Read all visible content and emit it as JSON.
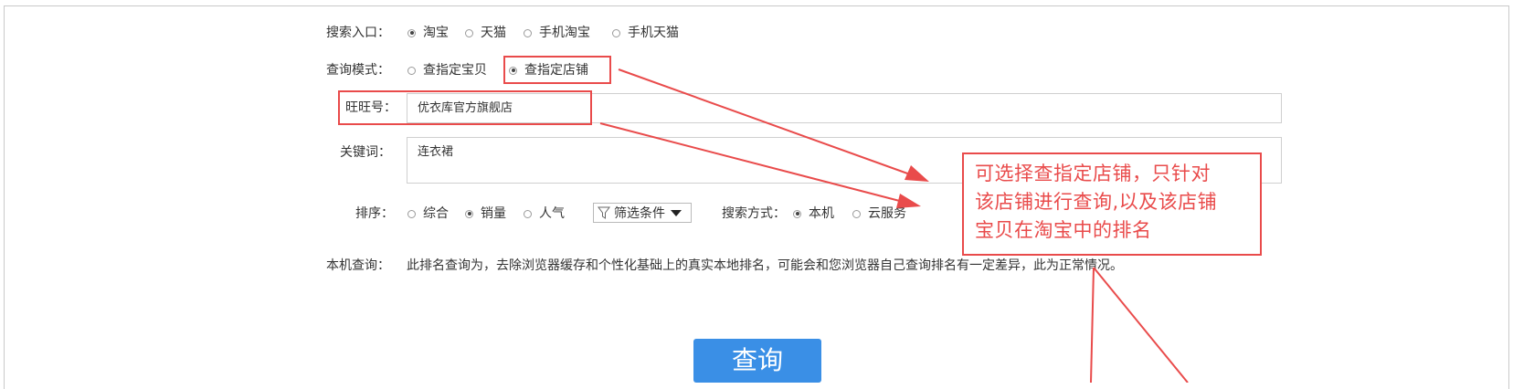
{
  "search_entry": {
    "label": "搜索入口：",
    "options": [
      {
        "label": "淘宝",
        "checked": true
      },
      {
        "label": "天猫",
        "checked": false
      },
      {
        "label": "手机淘宝",
        "checked": false
      },
      {
        "label": "手机天猫",
        "checked": false
      }
    ]
  },
  "query_mode": {
    "label": "查询模式：",
    "options": [
      {
        "label": "查指定宝贝",
        "checked": false
      },
      {
        "label": "查指定店铺",
        "checked": true
      }
    ]
  },
  "wangwang": {
    "label": "旺旺号：",
    "value": "优衣库官方旗舰店"
  },
  "keyword": {
    "label": "关键词：",
    "value": "连衣裙"
  },
  "sort": {
    "label": "排序：",
    "options": [
      {
        "label": "综合",
        "checked": false
      },
      {
        "label": "销量",
        "checked": true
      },
      {
        "label": "人气",
        "checked": false
      }
    ],
    "filter_label": "筛选条件"
  },
  "search_method": {
    "label": "搜索方式：",
    "options": [
      {
        "label": "本机",
        "checked": true
      },
      {
        "label": "云服务",
        "checked": false
      }
    ]
  },
  "local_query": {
    "label": "本机查询：",
    "text": "此排名查询为，去除浏览器缓存和个性化基础上的真实本地排名，可能会和您浏览器自己查询排名有一定差异，此为正常情况。"
  },
  "query_button": "查询",
  "annotation": {
    "line1": "可选择查指定店铺，只针对",
    "line2": "该店铺进行查询,以及该店铺",
    "line3": "宝贝在淘宝中的排名",
    "color": "#e94b4b"
  },
  "colors": {
    "accent": "#3a8fe6",
    "annotation": "#e94b4b"
  }
}
